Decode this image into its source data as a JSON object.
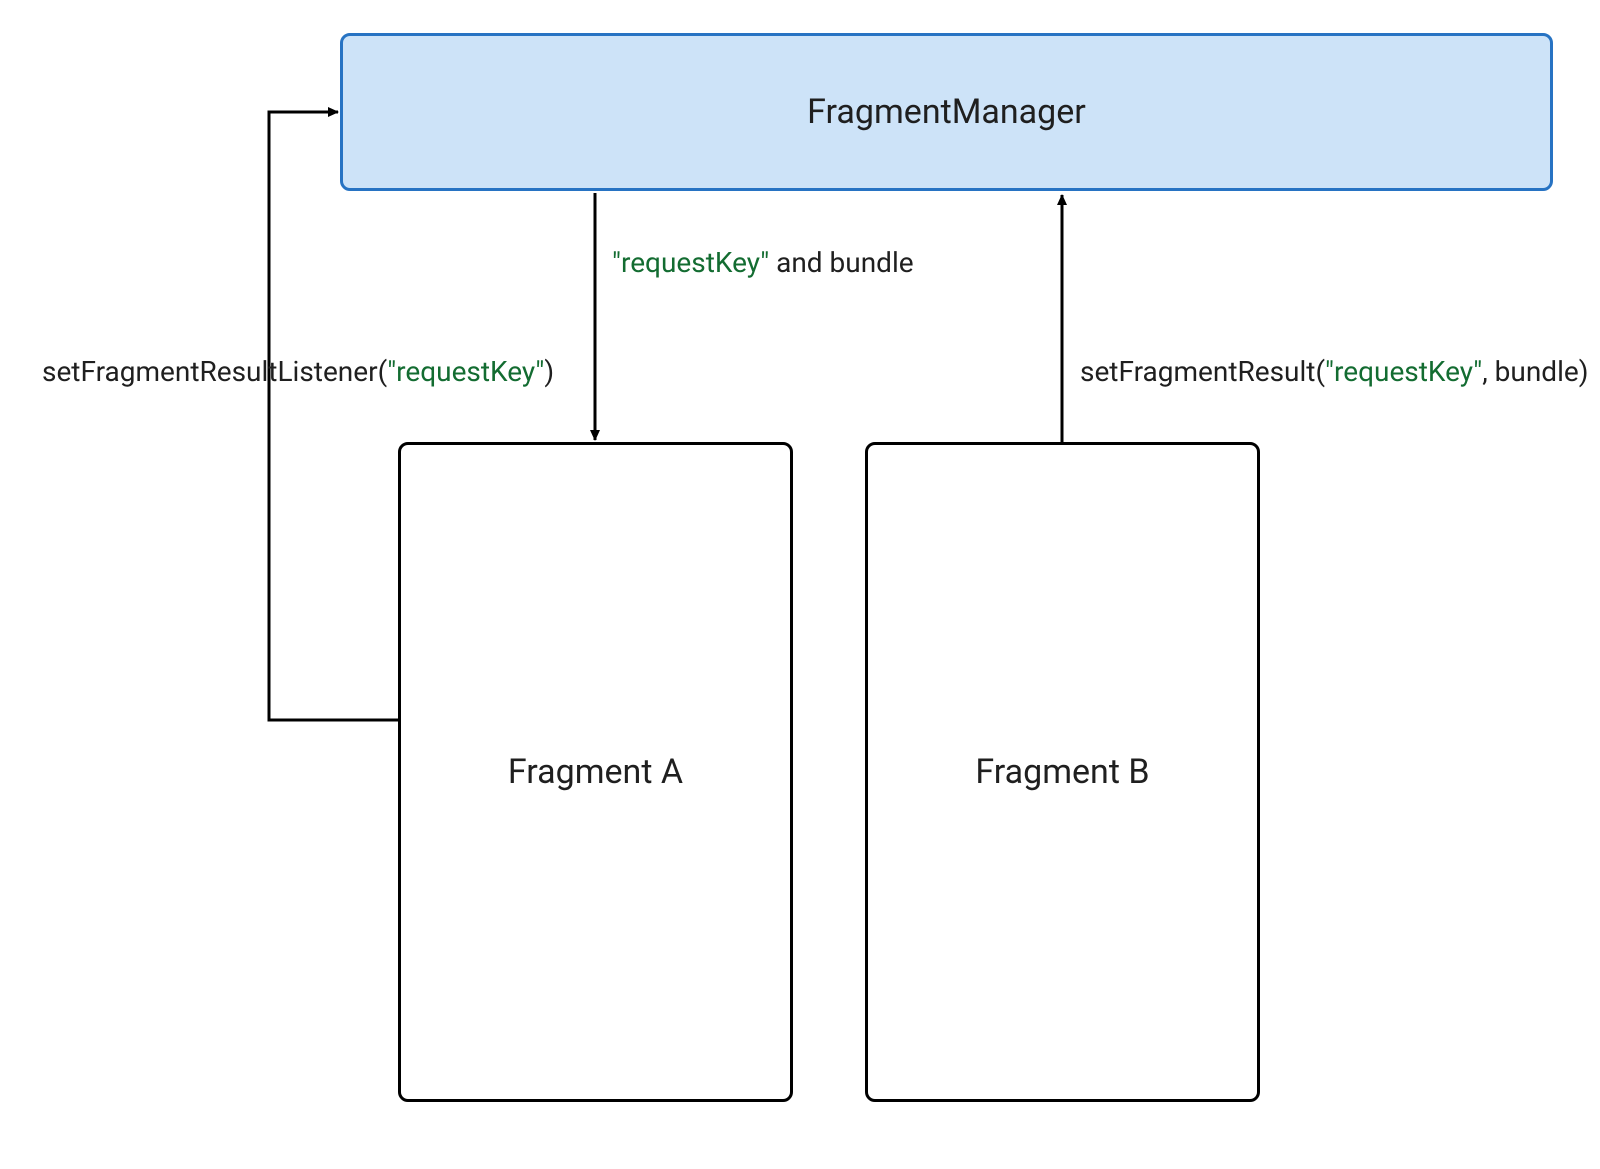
{
  "nodes": {
    "manager": {
      "label": "FragmentManager"
    },
    "fragA": {
      "label": "Fragment A"
    },
    "fragB": {
      "label": "Fragment B"
    }
  },
  "labels": {
    "listener": {
      "prefix": "setFragmentResultListener(",
      "key": "\"requestKey\"",
      "suffix": ")"
    },
    "toA": {
      "key": "\"requestKey\"",
      "rest": " and bundle"
    },
    "result": {
      "prefix": "setFragmentResult(",
      "key": "\"requestKey\"",
      "suffix": ", bundle)"
    }
  },
  "colors": {
    "managerFill": "#cde3f8",
    "managerStroke": "#2773c3",
    "text": "#1f1f1f",
    "keyString": "#136c31",
    "boxStroke": "#000000"
  }
}
